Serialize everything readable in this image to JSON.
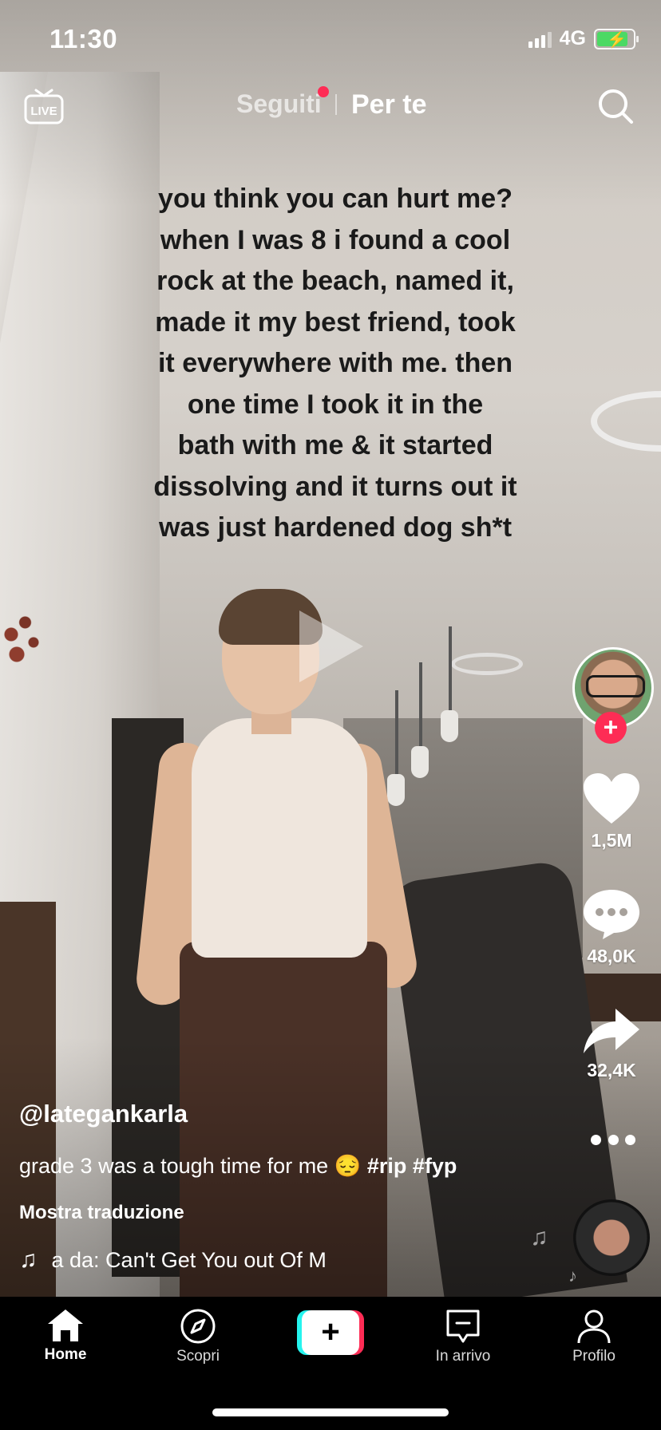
{
  "status_bar": {
    "time": "11:30",
    "network": "4G"
  },
  "top_nav": {
    "live_label": "LIVE",
    "tab_following": "Seguiti",
    "tab_for_you": "Per te"
  },
  "video": {
    "overlay_lines": [
      "you think you can hurt me?",
      "when I was 8 i found a cool",
      "rock at the beach, named it,",
      "made it my best friend, took",
      "it everywhere with me. then",
      "one time I took it in the",
      "bath with me & it started",
      "dissolving and it turns out it",
      "was just hardened dog sh*t"
    ]
  },
  "rail": {
    "follow_symbol": "+",
    "likes": "1,5M",
    "comments": "48,0K",
    "shares": "32,4K"
  },
  "post": {
    "username": "@lategankarla",
    "description": "grade 3 was a tough time for me 😔",
    "hashtags": [
      "#rip",
      "#fyp"
    ],
    "translate": "Mostra traduzione",
    "music": "a da: Can't Get You out Of M"
  },
  "tabbar": {
    "home": "Home",
    "discover": "Scopri",
    "create_symbol": "+",
    "inbox": "In arrivo",
    "profile": "Profilo"
  }
}
